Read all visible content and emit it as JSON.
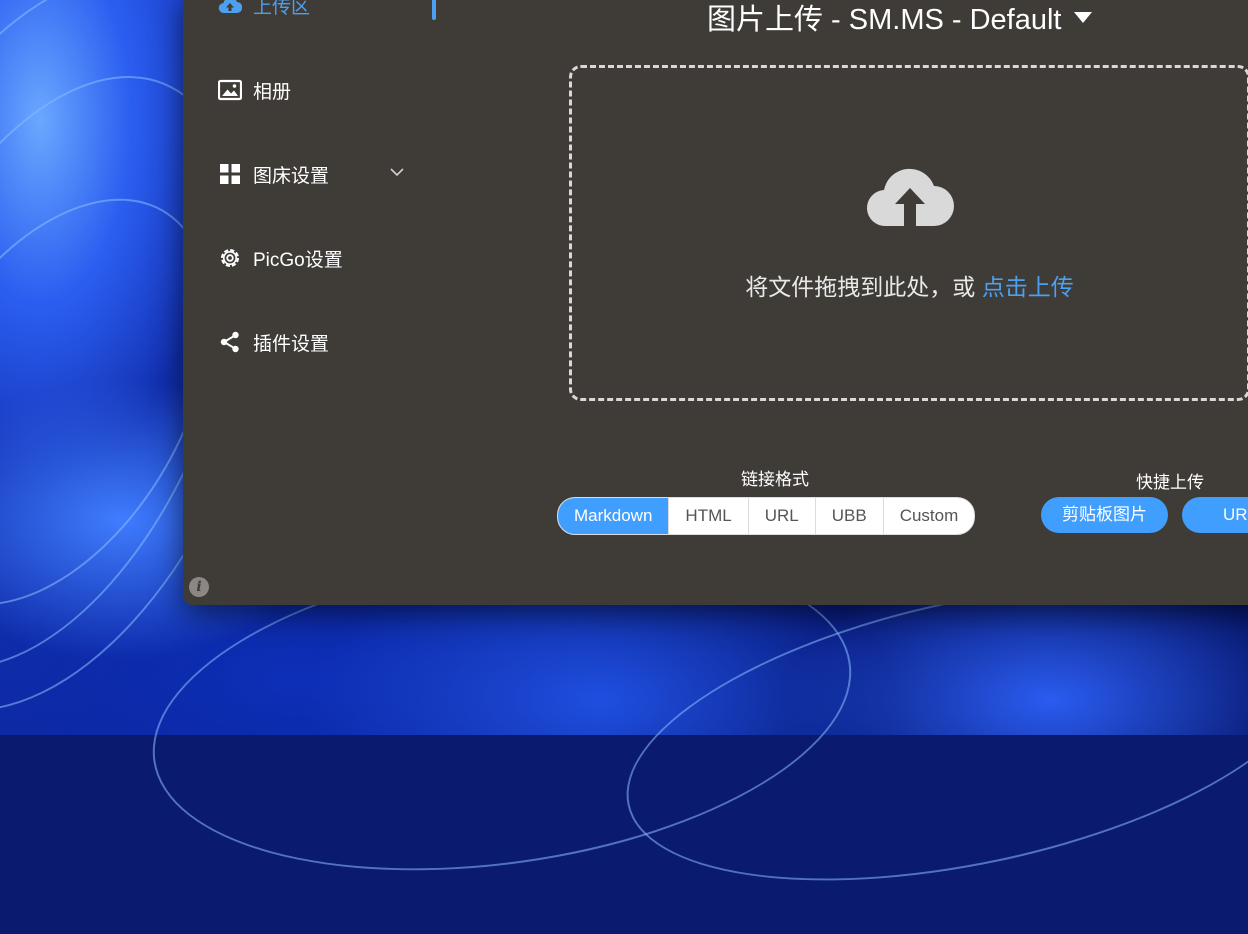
{
  "sidebar": {
    "items": [
      {
        "label": "上传区",
        "icon": "cloud-upload-icon"
      },
      {
        "label": "相册",
        "icon": "image-icon"
      },
      {
        "label": "图床设置",
        "icon": "grid-icon"
      },
      {
        "label": "PicGo设置",
        "icon": "gear-icon"
      },
      {
        "label": "插件设置",
        "icon": "share-icon"
      }
    ],
    "info_glyph": "i"
  },
  "main": {
    "title": "图片上传 - SM.MS - Default",
    "dropzone": {
      "text": "将文件拖拽到此处，或 ",
      "link": "点击上传"
    },
    "link_format": {
      "label": "链接格式",
      "options": [
        "Markdown",
        "HTML",
        "URL",
        "UBB",
        "Custom"
      ],
      "selected": "Markdown"
    },
    "quick_upload": {
      "label": "快捷上传",
      "buttons": [
        "剪贴板图片",
        "URL"
      ]
    }
  },
  "colors": {
    "accent": "#409eff",
    "window_bg": "#3f3c38",
    "active_nav": "#4d9ff0"
  }
}
